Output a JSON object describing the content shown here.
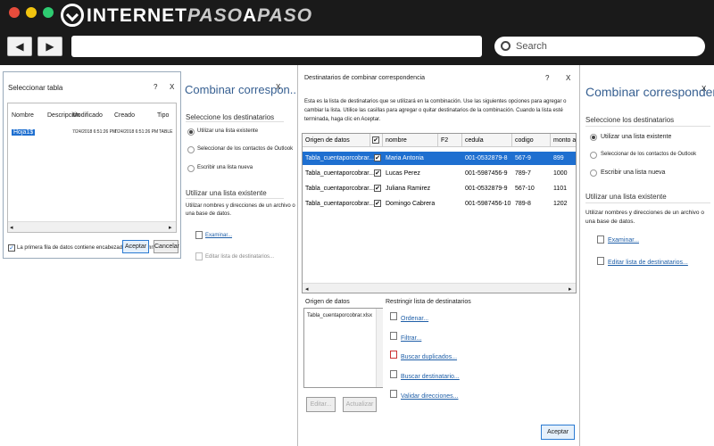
{
  "browser": {
    "brand": {
      "part1": "INTERNET",
      "part2": "PASO",
      "part3": "A",
      "part4": "PASO"
    },
    "search_placeholder": "Search",
    "back_icon": "◀",
    "forward_icon": "▶",
    "colors": {
      "bar": "#1a1a1a",
      "red": "#e74c3c",
      "yellow": "#f1c40f",
      "green": "#2ecc71"
    }
  },
  "select_table": {
    "title": "Seleccionar tabla",
    "help": "?",
    "close": "X",
    "columns": [
      "Nombre",
      "Descripción",
      "Modificado",
      "Creado",
      "Tipo"
    ],
    "row": {
      "name": "Hoja1$",
      "modified": "7/24/2018 6:51:26 PM",
      "created": "7/24/2018 6:51:26 PM",
      "type": "TABLE"
    },
    "first_row_label": "La primera fila de datos contiene encabezados de columna",
    "ok": "Aceptar",
    "cancel": "Cancelar"
  },
  "left_panel": {
    "title": "Combinar correspon...",
    "close": "X",
    "choose_title": "Seleccione los destinatarios",
    "options": [
      "Utilizar una lista existente",
      "Seleccionar de los contactos de Outlook",
      "Escribir una lista nueva"
    ],
    "existing_title": "Utilizar una lista existente",
    "existing_desc_1": "Utilizar nombres y direcciones de un archivo o",
    "existing_desc_2": "una base de datos.",
    "browse": "Examinar...",
    "edit_list": "Editar lista de destinatarios..."
  },
  "recipients": {
    "title": "Destinatarios de combinar correspondencia",
    "help": "?",
    "close": "X",
    "desc_1": "Esta es la lista de destinatarios que se utilizará en la combinación. Use las siguientes opciones para agregar o",
    "desc_2": "cambiar la lista. Utilice las casillas para agregar o quitar destinatarios de la combinación. Cuando la lista esté",
    "desc_3": "terminada, haga clic en Aceptar.",
    "headers": [
      "Origen de datos",
      "nombre",
      "F2",
      "cedula",
      "codigo",
      "monto a pag"
    ],
    "check_mark": "✔",
    "rows": [
      {
        "source": "Tabla_cuentaporcobrar...",
        "name": "Maria Antonia",
        "cedula": "001-0532879-8",
        "codigo": "567-9",
        "monto": "899"
      },
      {
        "source": "Tabla_cuentaporcobrar...",
        "name": "Lucas Perez",
        "cedula": "001-5987456-9",
        "codigo": "789-7",
        "monto": "1000"
      },
      {
        "source": "Tabla_cuentaporcobrar...",
        "name": "Juliana Ramirez",
        "cedula": "001-0532879-9",
        "codigo": "567-10",
        "monto": "1101"
      },
      {
        "source": "Tabla_cuentaporcobrar...",
        "name": "Domingo Cabrera",
        "cedula": "001-5987456-10",
        "codigo": "789-8",
        "monto": "1202"
      }
    ],
    "datasource_label": "Origen de datos",
    "datasource_file": "Tabla_cuentaporcobrar.xlsx",
    "restrict_label": "Restringir lista de destinatarios",
    "links": [
      "Ordenar...",
      "Filtrar...",
      "Buscar duplicados...",
      "Buscar destinatario...",
      "Validar direcciones..."
    ],
    "edit_btn": "Editar...",
    "refresh_btn": "Actualizar",
    "ok": "Aceptar"
  },
  "right_panel": {
    "title": "Combinar correspondenc...",
    "close": "X",
    "choose_title": "Seleccione los destinatarios",
    "options": [
      "Utilizar una lista existente",
      "Seleccionar de los contactos de Outlook",
      "Escribir una lista nueva"
    ],
    "existing_title": "Utilizar una lista existente",
    "existing_desc_1": "Utilizar nombres y direcciones de un archivo o",
    "existing_desc_2": "una base de datos.",
    "browse": "Examinar...",
    "edit_list": "Editar lista de destinatarios..."
  }
}
